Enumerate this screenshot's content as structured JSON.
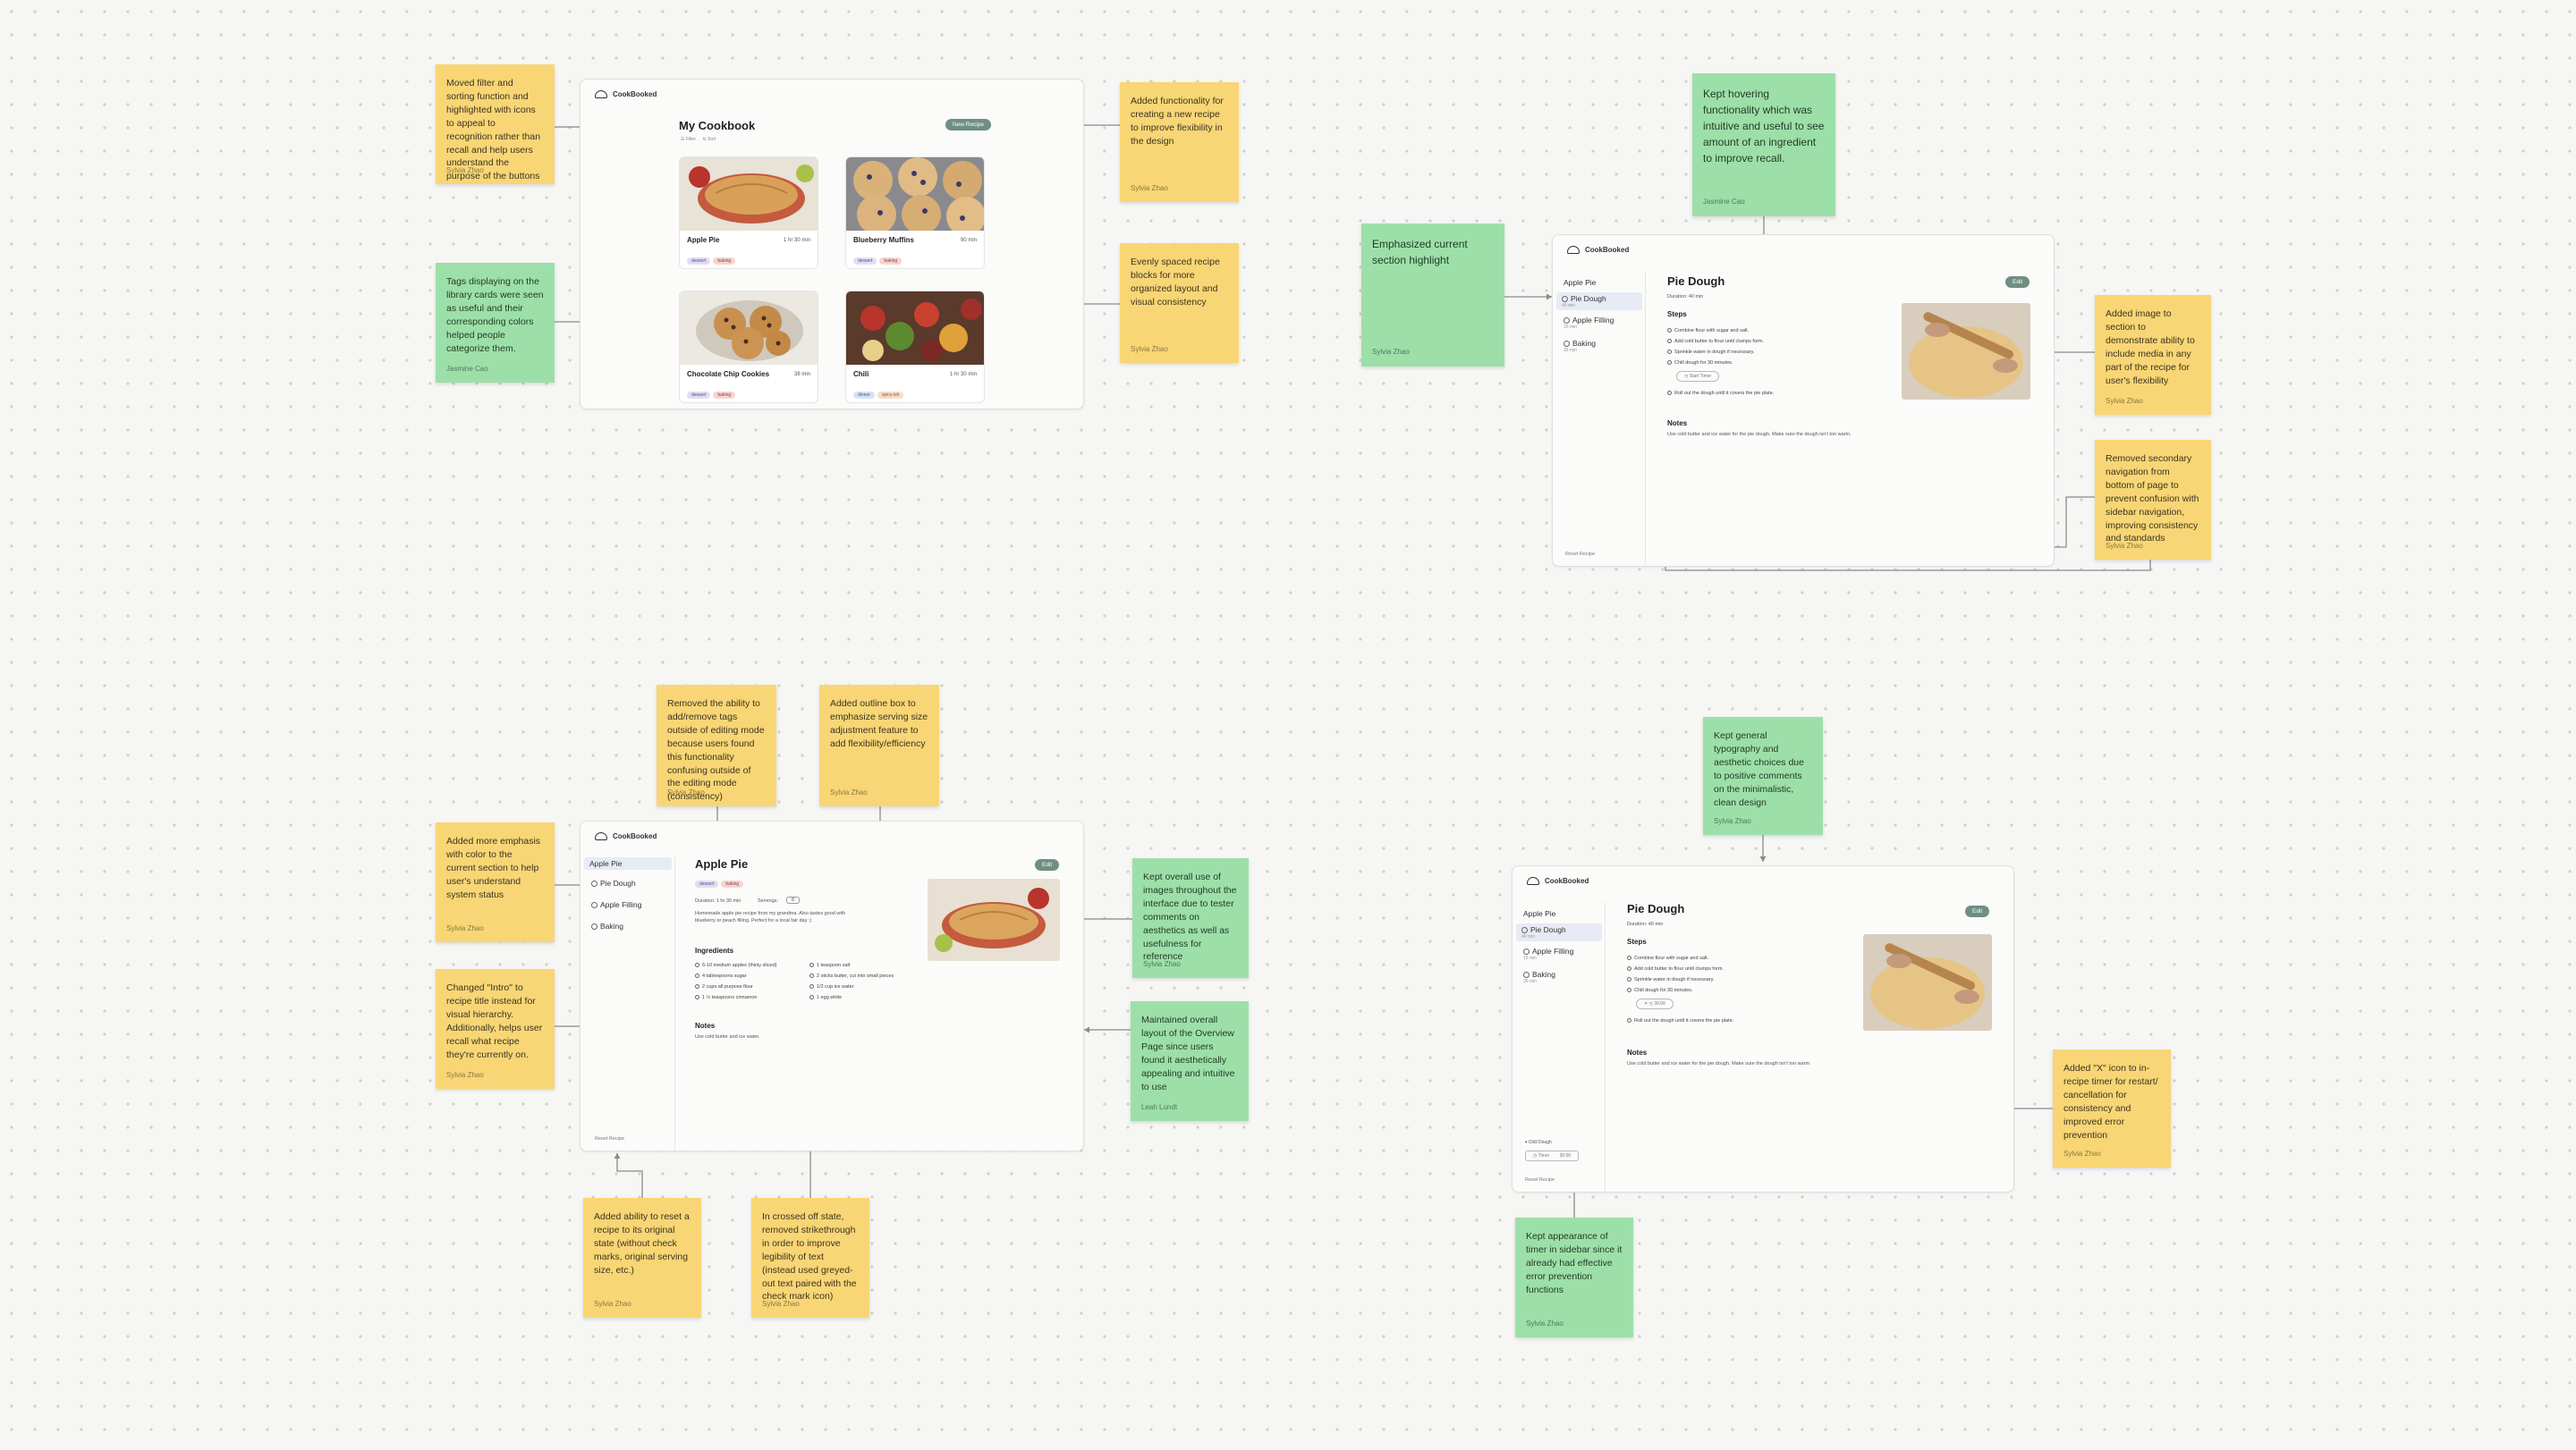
{
  "app": {
    "brand": "CookBooked"
  },
  "frame1": {
    "title": "My Cookbook",
    "new_button": "New Recipe",
    "filters": [
      "Filter",
      "Sort"
    ],
    "cards": [
      {
        "title": "Apple Pie",
        "time": "1 hr 30 min",
        "tags": [
          "dessert",
          "baking"
        ]
      },
      {
        "title": "Blueberry Muffins",
        "time": "90 min",
        "tags": [
          "dessert",
          "baking"
        ]
      },
      {
        "title": "Chocolate Chip Cookies",
        "time": "38 min",
        "tags": [
          "dessert",
          "baking"
        ]
      },
      {
        "title": "Chili",
        "time": "1 hr 30 min",
        "tags": [
          "dinner",
          "spicy-ish"
        ]
      }
    ]
  },
  "frame2": {
    "sidebar": [
      {
        "label": "Apple Pie"
      },
      {
        "label": "Pie Dough",
        "sub": "40 min"
      },
      {
        "label": "Apple Filling",
        "sub": "15 min"
      },
      {
        "label": "Baking",
        "sub": "35 min"
      }
    ],
    "title": "Pie Dough",
    "edit": "Edit",
    "duration": "Duration: 40 min",
    "steps_label": "Steps",
    "steps": [
      "Combine flour with sugar and salt.",
      "Add cold butter to flour until clumps form.",
      "Sprinkle water in dough if necessary.",
      "Chill dough for 30 minutes.",
      "Roll out the dough until it covers the pie plate."
    ],
    "timer": "Start Timer",
    "notes_label": "Notes",
    "notes": "Use cold butter and ice water for the pie dough. Make sure the dough isn't too warm.",
    "reset": "Reset Recipe"
  },
  "frame3": {
    "sidebar": [
      {
        "label": "Apple Pie"
      },
      {
        "label": "Pie Dough"
      },
      {
        "label": "Apple Filling"
      },
      {
        "label": "Baking"
      }
    ],
    "title": "Apple Pie",
    "edit": "Edit",
    "tags": [
      "dessert",
      "baking"
    ],
    "duration": "Duration: 1 hr 30 min",
    "servings_label": "Servings:",
    "servings_value": "8",
    "intro": "Homemade apple pie recipe from my grandma. Also tastes good with blueberry or peach filling. Perfect for a local fair day :)",
    "ingredients_label": "Ingredients",
    "ingredients_left": [
      "6-10 medium apples (thinly sliced)",
      "4 tablespoons sugar",
      "2 cups all purpose flour",
      "1 ½ teaspoons cinnamon"
    ],
    "ingredients_right": [
      "1 teaspoon salt",
      "2 sticks butter, cut into small pieces",
      "1/2 cup ice water",
      "1 egg white"
    ],
    "notes_label": "Notes",
    "notes": "Use cold butter and ice water.",
    "reset": "Reset Recipe"
  },
  "frame4": {
    "sidebar": [
      {
        "label": "Apple Pie"
      },
      {
        "label": "Pie Dough",
        "sub": "40 min"
      },
      {
        "label": "Apple Filling",
        "sub": "15 min"
      },
      {
        "label": "Baking",
        "sub": "35 min"
      }
    ],
    "title": "Pie Dough",
    "edit": "Edit",
    "duration": "Duration: 40 min",
    "steps_label": "Steps",
    "steps": [
      "Combine flour with sugar and salt.",
      "Add cold butter to flour until clumps form.",
      "Sprinkle water in dough if necessary.",
      "Chill dough for 30 minutes.",
      "Roll out the dough until it covers the pie plate."
    ],
    "timer": "30:00",
    "notes_label": "Notes",
    "notes": "Use cold butter and ice water for the pie dough. Make sure the dough isn't too warm.",
    "sidebar_timer_label": "Chill Dough",
    "sidebar_timer_left": "Timer",
    "sidebar_timer_right": "30:00",
    "reset": "Reset Recipe"
  },
  "notes": [
    {
      "id": "n1",
      "text": "Moved filter and sorting function and highlighted with icons to appeal to recognition rather than recall and help users understand the purpose of the buttons",
      "author": "Sylvia Zhao"
    },
    {
      "id": "n2",
      "text": "Tags displaying on the library cards were seen as useful and their corresponding colors helped people categorize them.",
      "author": "Jasmine Cao"
    },
    {
      "id": "n3",
      "text": "Added functionality for creating a new recipe to improve flexibility in the design",
      "author": "Sylvia Zhao"
    },
    {
      "id": "n4",
      "text": "Evenly spaced recipe blocks for more organized layout and visual consistency",
      "author": "Sylvia Zhao"
    },
    {
      "id": "n5",
      "text": "Kept hovering functionality which was intuitive and useful to see amount of an ingredient to improve recall.",
      "author": "Jasmine Cao"
    },
    {
      "id": "n6",
      "text": "Emphasized current section highlight",
      "author": "Sylvia Zhao"
    },
    {
      "id": "n7",
      "text": "Added image to section to demonstrate ability to include media in any part of the recipe for user's flexibility",
      "author": "Sylvia Zhao"
    },
    {
      "id": "n8",
      "text": "Removed secondary navigation from bottom of page to prevent confusion with sidebar navigation, improving consistency and standards",
      "author": "Sylvia Zhao"
    },
    {
      "id": "n9",
      "text": "Removed the ability to add/remove tags outside of editing mode because users found this functionality confusing outside of the editing mode (consistency)",
      "author": "Sylvia Zhao"
    },
    {
      "id": "n10",
      "text": "Added outline box to emphasize serving size adjustment feature to add flexibility/efficiency",
      "author": "Sylvia Zhao"
    },
    {
      "id": "n11",
      "text": "Added more emphasis with color to the current section to help user's understand system status",
      "author": "Sylvia Zhao"
    },
    {
      "id": "n12",
      "text": "Changed \"Intro\" to recipe title instead for visual hierarchy. Additionally, helps user recall what recipe they're currently on.",
      "author": "Sylvia Zhao"
    },
    {
      "id": "n13",
      "text": "Kept overall use of images throughout the interface due to tester comments on aesthetics as well as usefulness for reference",
      "author": "Sylvia Zhao"
    },
    {
      "id": "n14",
      "text": "Maintained overall layout of the Overview Page since users found it aesthetically appealing and intuitive to use",
      "author": "Leah Lundt"
    },
    {
      "id": "n15",
      "text": "Added ability to reset a recipe to its original state (without check marks, original serving size, etc.)",
      "author": "Sylvia Zhao"
    },
    {
      "id": "n16",
      "text": "In crossed off state, removed strikethrough in order to improve legibility of text (instead used greyed-out text paired with the check mark icon)",
      "author": "Sylvia Zhao"
    },
    {
      "id": "n17",
      "text": "Kept general typography and aesthetic choices due to positive comments on the minimalistic, clean design",
      "author": "Sylvia Zhao"
    },
    {
      "id": "n18",
      "text": "Added \"X\" icon to in-recipe timer for restart/ cancellation for consistency and improved error prevention",
      "author": "Sylvia Zhao"
    },
    {
      "id": "n19",
      "text": "Kept appearance of timer in sidebar since it already had effective error prevention functions",
      "author": "Sylvia Zhao"
    }
  ],
  "colors": {
    "yellow": "#f8d675",
    "green": "#9ddfa9",
    "accent": "#6f8f82"
  }
}
